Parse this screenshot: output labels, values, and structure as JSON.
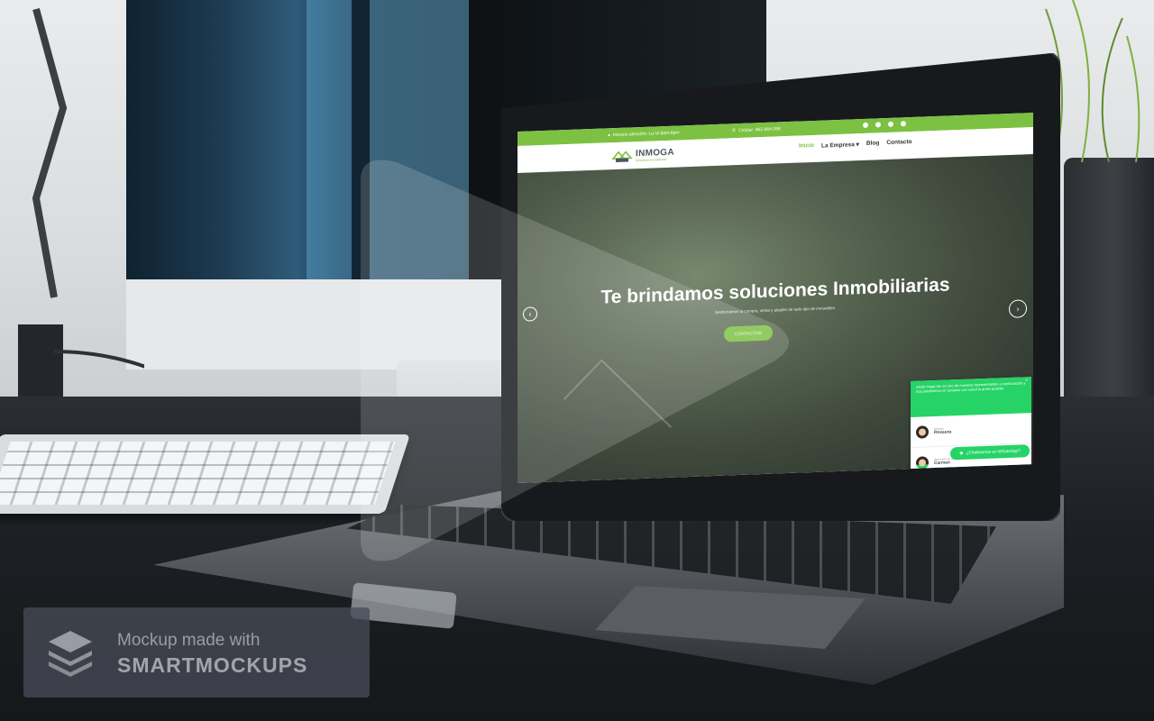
{
  "website": {
    "topbar": {
      "hours": "Horario atención: Lu-Vi 8am-6pm",
      "phone": "Celular: 962 864 058"
    },
    "logo": {
      "name": "INMOGA",
      "tagline": "Eficiencia Inmobiliaria"
    },
    "nav": {
      "items": [
        {
          "label": "Inicio"
        },
        {
          "label": "La Empresa ▾"
        },
        {
          "label": "Blog"
        },
        {
          "label": "Contacto"
        }
      ]
    },
    "hero": {
      "title": "Te brindamos soluciones Inmobiliarias",
      "subtitle": "Gestionamos la compra, venta y alquiler de todo tipo de inmuebles.",
      "cta": "CONTACTAR",
      "prev_arrow": "‹",
      "next_arrow": "›"
    },
    "whatsapp": {
      "intro": "¡Hola! Haga clic en uno de nuestros representantes a continuación y nos pondremos en contacto con usted lo antes posible.",
      "close": "×",
      "agents": [
        {
          "role": "Ventas",
          "name": "Rosaura"
        },
        {
          "role": "Atención al cliente",
          "name": "Carmen"
        }
      ],
      "button": "¿Chateamos en WhatsApp?"
    },
    "colors": {
      "brand_green": "#7cc142",
      "whatsapp_green": "#25d366"
    }
  },
  "watermark": {
    "line1": "Mockup made with",
    "line2": "SMARTMOCKUPS"
  }
}
